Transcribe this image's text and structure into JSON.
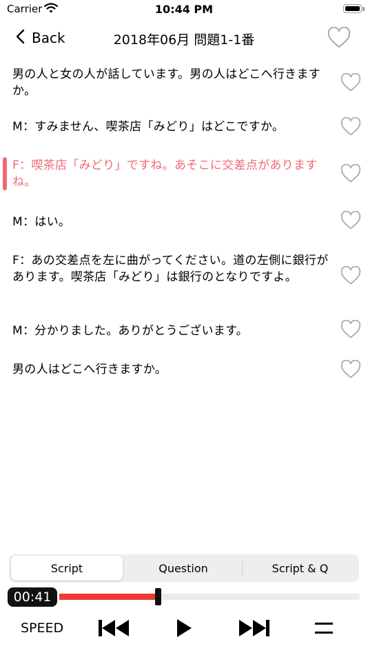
{
  "status": {
    "carrier": "Carrier",
    "time": "10:44 PM"
  },
  "nav": {
    "back_label": "Back",
    "title": "2018年06月 問題1-1番"
  },
  "script_lines": [
    {
      "text": "男の人と女の人が話しています。男の人はどこへ行きますか。",
      "active": false
    },
    {
      "text": "M：すみません、喫茶店「みどり」はどこですか。",
      "active": false
    },
    {
      "text": "F：喫茶店「みどり」ですね。あそこに交差点がありますね。",
      "active": true
    },
    {
      "text": "M：はい。",
      "active": false
    },
    {
      "text": "F：あの交差点を左に曲がってください。道の左側に銀行があります。喫茶店「みどり」は銀行のとなりですよ。",
      "active": false
    },
    {
      "text": "M：分かりました。ありがとうございます。",
      "active": false
    },
    {
      "text": "男の人はどこへ行きますか。",
      "active": false
    }
  ],
  "segments": {
    "items": [
      "Script",
      "Question",
      "Script & Q"
    ],
    "selected": "Script"
  },
  "player": {
    "elapsed": "00:41",
    "progress": 0.33,
    "speed_label": "SPEED"
  },
  "colors": {
    "accent": "#f06875",
    "progress": "#ef3a32"
  },
  "icons": [
    "wifi-icon",
    "battery-icon",
    "chevron-left-icon",
    "heart-outline-icon",
    "skip-back-icon",
    "play-icon",
    "skip-forward-icon",
    "menu-icon"
  ]
}
